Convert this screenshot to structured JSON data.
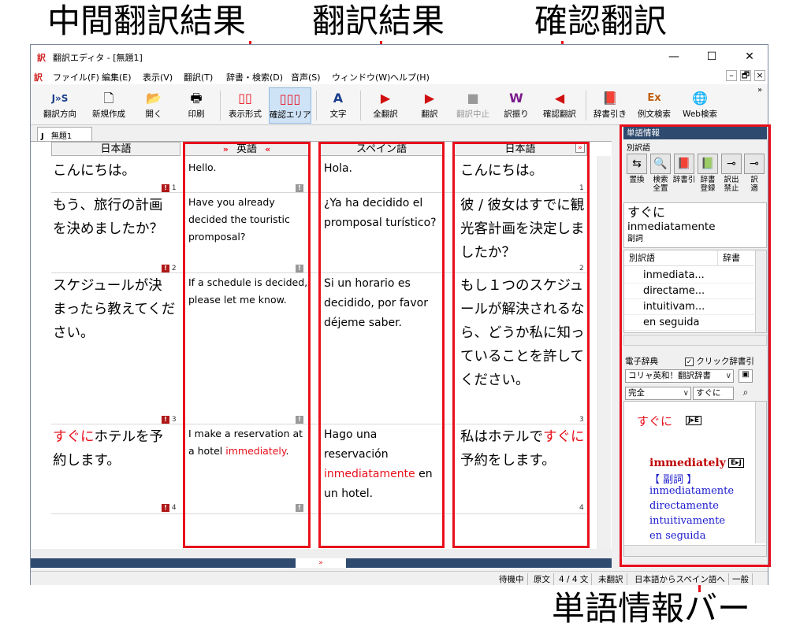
{
  "callouts": {
    "intermediate": "中間翻訳結果",
    "translation": "翻訳結果",
    "confirm": "確認翻訳",
    "wordbar": "単語情報バー"
  },
  "window": {
    "title": "翻訳エディタ - [無題1]",
    "app_icon": "訳",
    "controls": {
      "minimize": "—",
      "maximize": "☐",
      "close": "✕"
    }
  },
  "menu": {
    "items": [
      "ファイル(F)",
      "編集(E)",
      "表示(V)",
      "翻訳(T)",
      "辞書・検索(D)",
      "音声(S)",
      "ウィンドウ(W)",
      "ヘルプ(H)"
    ],
    "mdi": {
      "minimize": "–",
      "restore": "🗗",
      "close": "×"
    }
  },
  "toolbar": {
    "buttons": [
      {
        "id": "direction",
        "label": "翻訳方向",
        "icon": "J»S"
      },
      {
        "id": "new",
        "label": "新規作成",
        "icon": "🗋"
      },
      {
        "id": "open",
        "label": "開く",
        "icon": "📂"
      },
      {
        "id": "print",
        "label": "印刷",
        "icon": "🖶"
      },
      {
        "id": "layout",
        "label": "表示形式",
        "icon": "▯▯"
      },
      {
        "id": "confirm_area",
        "label": "確認エリア",
        "icon": "▯▯▯"
      },
      {
        "id": "text",
        "label": "文字",
        "icon": "A"
      },
      {
        "id": "all_translate",
        "label": "全翻訳",
        "icon": "▶"
      },
      {
        "id": "translate",
        "label": "翻訳",
        "icon": "▶"
      },
      {
        "id": "stop",
        "label": "翻訳中止",
        "icon": "■"
      },
      {
        "id": "furigana",
        "label": "訳振り",
        "icon": "W"
      },
      {
        "id": "confirm_translate",
        "label": "確認翻訳",
        "icon": "◀"
      },
      {
        "id": "dict_lookup",
        "label": "辞書引き",
        "icon": "📕"
      },
      {
        "id": "example_search",
        "label": "例文検索",
        "icon": "Ex"
      },
      {
        "id": "web_search",
        "label": "Web検索",
        "icon": "🌐"
      }
    ],
    "overflow": "»"
  },
  "document": {
    "tab": "無題1",
    "tab_prefix": "J",
    "columns": {
      "source": "日本語",
      "intermediate": "英語",
      "target": "スペイン語",
      "confirm": "日本語"
    },
    "rows": [
      {
        "num": "1",
        "ja": "こんにちは。",
        "en": "Hello.",
        "es": "Hola.",
        "confirm": "こんにちは。"
      },
      {
        "num": "2",
        "ja": "もう、旅行の計画を決めましたか？",
        "en": "Have you already decided the touristic promposal?",
        "es": "¿Ya ha decidido el promposal turístico?",
        "confirm": "彼 / 彼女はすでに観光客計画を決定しましたか？"
      },
      {
        "num": "3",
        "ja": "スケジュールが決まったら教えてください。",
        "en": "If a schedule is decided, please let me know.",
        "es": "Si un horario es decidido, por favor déjeme saber.",
        "confirm": "もし１つのスケジュールが解決されるなら、どうか私に知っていることを許してください。"
      },
      {
        "num": "4",
        "ja_hl": "すぐに",
        "ja_rest": "ホテルを予約します。",
        "en_pre": "I make a reservation at a hotel ",
        "en_hl": "immediately",
        "en_post": ".",
        "es_pre": "Hago una reservación ",
        "es_hl": "inmediatamente",
        "es_post": " en un hotel.",
        "confirm_pre": "私はホテルで",
        "confirm_hl": "すぐに",
        "confirm_post": "予約をします。"
      }
    ]
  },
  "status": {
    "items": [
      "待機中",
      "原文",
      "4 / 4 文",
      "未翻訳",
      "日本語からスペイン語へ",
      "一般"
    ]
  },
  "sidebar": {
    "title": "単語情報",
    "sub": "別訳語",
    "buttons": [
      {
        "label": "置換",
        "icon": "⇆"
      },
      {
        "label": "検索\n全置",
        "icon": "🔍"
      },
      {
        "label": "辞書引",
        "icon": "📕"
      },
      {
        "label": "辞書\n登録",
        "icon": "📗"
      },
      {
        "label": "訳出\n禁止",
        "icon": "⊸"
      },
      {
        "label": "訳\n適",
        "icon": "⊸"
      }
    ],
    "word": {
      "source": "すぐに",
      "translation": "inmediatamente",
      "pos": "副詞"
    },
    "alt_head": {
      "word": "別訳語",
      "dict": "辞書"
    },
    "alternatives": [
      "inmediata...",
      "directame...",
      "intuitivam...",
      "en seguida"
    ],
    "dict_label": "電子辞典",
    "click_lookup": "クリック辞書引",
    "dict_select": "コリャ英和！翻訳辞書",
    "match_select": "完全",
    "search_value": "すぐに",
    "dict": {
      "headword": "すぐに",
      "badge": "J▸E",
      "entry": "immediately",
      "entry_badge": "E▸J",
      "pos": "【 副詞 】",
      "translations": [
        "inmediatamente",
        "directamente",
        "intuitivamente",
        "en seguida"
      ]
    }
  }
}
